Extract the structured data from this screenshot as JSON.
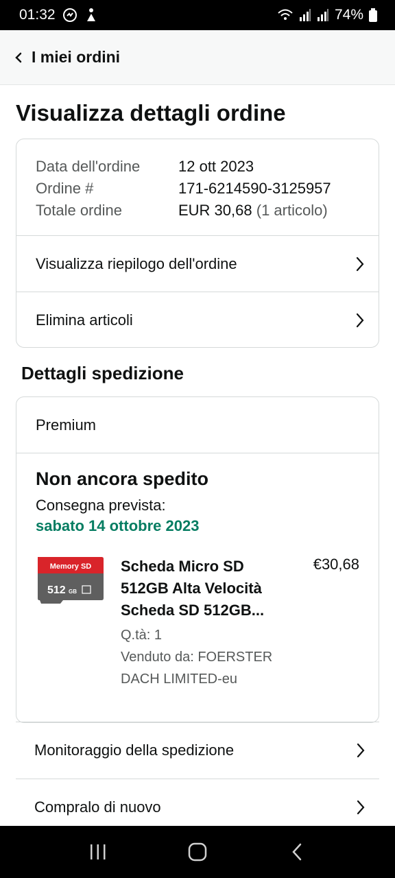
{
  "status_bar": {
    "time": "01:32",
    "battery": "74%"
  },
  "header": {
    "back_label": "I miei ordini"
  },
  "page_title": "Visualizza dettagli ordine",
  "order_summary": {
    "date_label": "Data dell'ordine",
    "date_value": "12 ott 2023",
    "order_label": "Ordine #",
    "order_value": "171-6214590-3125957",
    "total_label": "Totale ordine",
    "total_value": "EUR 30,68",
    "total_items": "(1 articolo)"
  },
  "order_actions": {
    "view_summary": "Visualizza riepilogo dell'ordine",
    "delete_items": "Elimina articoli"
  },
  "shipping_section": {
    "title": "Dettagli spedizione",
    "method": "Premium",
    "status": "Non ancora spedito",
    "delivery_label": "Consegna prevista:",
    "delivery_date": "sabato 14 ottobre 2023",
    "delivery_color": "#067d62"
  },
  "item": {
    "name": "Scheda Micro SD 512GB Alta Velocità Scheda SD 512GB...",
    "price": "€30,68",
    "quantity": "Q.tà: 1",
    "seller": "Venduto da: FOERSTER DACH LIMITED-eu",
    "image_label": "Memory SD",
    "image_capacity": "512",
    "image_unit": "GB"
  },
  "shipment_actions": {
    "tracking": "Monitoraggio della spedizione",
    "buy_again": "Compralo di nuovo"
  }
}
